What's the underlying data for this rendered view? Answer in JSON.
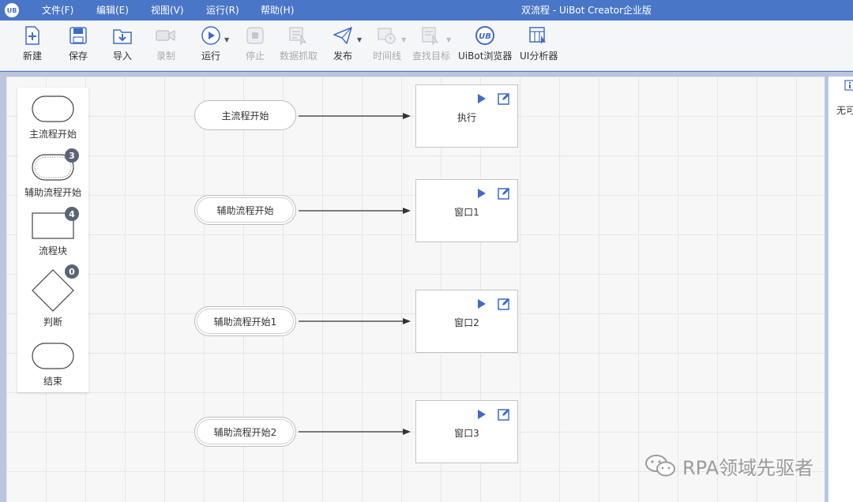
{
  "window": {
    "title": "双流程 - UiBot Creator企业版",
    "logo_text": "UB"
  },
  "menu": [
    "文件(F)",
    "编辑(E)",
    "视图(V)",
    "运行(R)",
    "帮助(H)"
  ],
  "toolbar": {
    "new": "新建",
    "save": "保存",
    "import": "导入",
    "record": "录制",
    "run": "运行",
    "stop": "停止",
    "data_scrape": "数据抓取",
    "publish": "发布",
    "timeline": "时间线",
    "find_target": "查找目标",
    "browser": "UiBot浏览器",
    "ui_analyzer": "UI分析器"
  },
  "palette": [
    {
      "label": "主流程开始",
      "count": null
    },
    {
      "label": "辅助流程开始",
      "count": "3"
    },
    {
      "label": "流程块",
      "count": "4"
    },
    {
      "label": "判断",
      "count": "0"
    },
    {
      "label": "结束",
      "count": null
    }
  ],
  "flow": [
    {
      "start": "主流程开始",
      "block": "执行"
    },
    {
      "start": "辅助流程开始",
      "block": "窗口1"
    },
    {
      "start": "辅助流程开始1",
      "block": "窗口2"
    },
    {
      "start": "辅助流程开始2",
      "block": "窗口3"
    }
  ],
  "right_panel": {
    "text": "无可"
  },
  "watermark": "RPA领域先驱者",
  "colors": {
    "brand_blue": "#4a76c7",
    "icon_blue": "#3f6bc6"
  }
}
